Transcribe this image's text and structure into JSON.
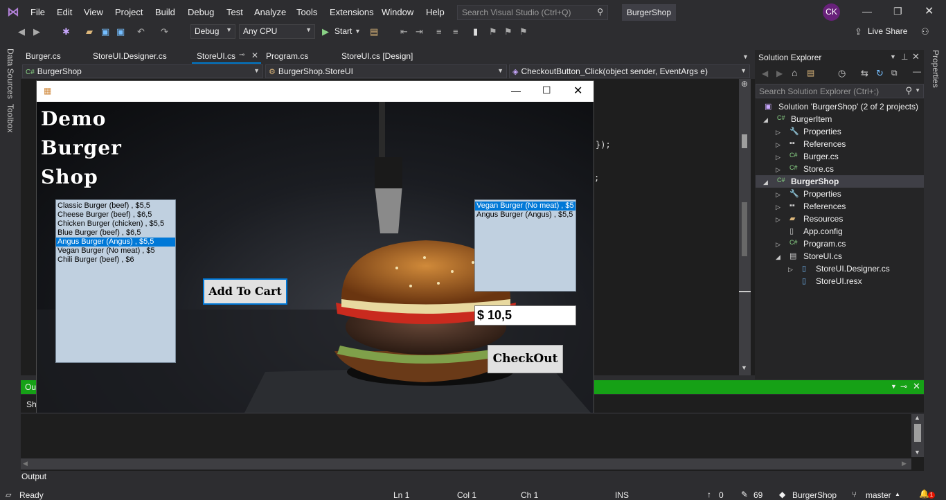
{
  "menubar": {
    "items": [
      "File",
      "Edit",
      "View",
      "Project",
      "Build",
      "Debug",
      "Test",
      "Analyze",
      "Tools",
      "Extensions",
      "Window",
      "Help"
    ],
    "search_placeholder": "Search Visual Studio (Ctrl+Q)",
    "solution_name": "BurgerShop",
    "avatar_initials": "CK"
  },
  "toolbar": {
    "config": "Debug",
    "platform": "Any CPU",
    "start_label": "Start",
    "live_share": "Live Share"
  },
  "tabs": [
    {
      "label": "Burger.cs"
    },
    {
      "label": "StoreUI.Designer.cs"
    },
    {
      "label": "StoreUI.cs"
    },
    {
      "label": "Program.cs"
    },
    {
      "label": "StoreUI.cs [Design]"
    }
  ],
  "navbar": {
    "project": "BurgerShop",
    "class": "BurgerShop.StoreUI",
    "member": "CheckoutButton_Click(object sender, EventArgs e)"
  },
  "code_fragments": [
    "});",
    ";"
  ],
  "left_strip": [
    "Data Sources",
    "Toolbox"
  ],
  "right_strip": "Properties",
  "solution_explorer": {
    "title": "Solution Explorer",
    "search_placeholder": "Search Solution Explorer (Ctrl+;)",
    "tree": [
      {
        "label": "Solution 'BurgerShop' (2 of 2 projects)"
      },
      {
        "label": "BurgerItem"
      },
      {
        "label": "Properties"
      },
      {
        "label": "References"
      },
      {
        "label": "Burger.cs"
      },
      {
        "label": "Store.cs"
      },
      {
        "label": "BurgerShop"
      },
      {
        "label": "Properties"
      },
      {
        "label": "References"
      },
      {
        "label": "Resources"
      },
      {
        "label": "App.config"
      },
      {
        "label": "Program.cs"
      },
      {
        "label": "StoreUI.cs"
      },
      {
        "label": "StoreUI.Designer.cs"
      },
      {
        "label": "StoreUI.resx"
      }
    ]
  },
  "output": {
    "header_fragment": "Ou",
    "show_fragment": "Sh",
    "tab_label": "Output"
  },
  "statusbar": {
    "ready": "Ready",
    "ln": "Ln 1",
    "col": "Col 1",
    "ch": "Ch 1",
    "ins": "INS",
    "up_count": "0",
    "edits": "69",
    "repo": "BurgerShop",
    "branch": "master",
    "notif_count": "1"
  },
  "app": {
    "title_lines": [
      "Demo",
      "Burger",
      "Shop"
    ],
    "menu_list": [
      "Classic Burger (beef) , $5,5",
      "Cheese Burger (beef) , $6,5",
      "Chicken Burger (chicken) , $5,5",
      "Blue Burger (beef) , $6,5",
      "Angus Burger (Angus) , $5,5",
      "Vegan Burger (No meat) , $5",
      "Chili Burger (beef) , $6"
    ],
    "menu_selected_index": 4,
    "cart_list": [
      "Vegan Burger (No meat) , $5",
      "Angus Burger (Angus) , $5,5"
    ],
    "cart_selected_index": 0,
    "add_to_cart_label": "Add To Cart",
    "total": "$ 10,5",
    "checkout_label": "CheckOut"
  }
}
